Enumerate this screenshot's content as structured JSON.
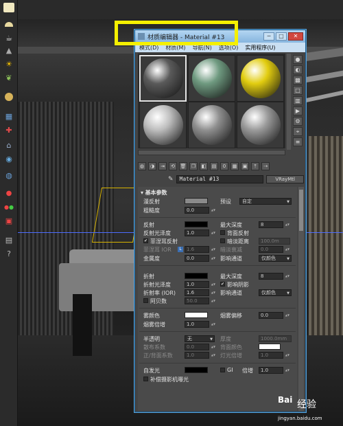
{
  "window": {
    "title": "材质编辑器 - Material #13",
    "controls": {
      "minimize": "─",
      "maximize": "□",
      "close": "✕"
    }
  },
  "menu": [
    "模式(D)",
    "材质(M)",
    "导航(N)",
    "选项(O)",
    "实用程序(U)"
  ],
  "slots": [
    {
      "color": "#5a5a5a",
      "selected": true
    },
    {
      "color": "#6f9a80",
      "selected": false
    },
    {
      "color": "#e2cd10",
      "selected": false
    },
    {
      "color": "#bdbdbd",
      "selected": false
    },
    {
      "color": "#8f8f8f",
      "selected": false
    },
    {
      "color": "#9a9a9a",
      "selected": false
    }
  ],
  "material_name": "Material #13",
  "material_type": "VRayMtl",
  "params": {
    "section_basic": "基本参数",
    "diffuse_label": "漫反射",
    "roughness_label": "粗糙度",
    "roughness_value": "0.0",
    "preset_label": "预设",
    "preset_value": "自定",
    "reflect_label": "反射",
    "max_depth_label": "最大深度",
    "reflect_max_depth": "8",
    "reflect_gloss_label": "反射光泽度",
    "reflect_gloss_value": "1.0",
    "back_reflect_label": "背面反射",
    "fresnel_label": "菲涅耳反射",
    "dim_dist_label": "暗淡距离",
    "dim_dist_value": "100.0m",
    "fresnel_ior_label": "菲涅耳 IOR",
    "fresnel_ior_value": "1.6",
    "dim_falloff_label": "暗淡衰减",
    "dim_falloff_value": "0.0",
    "metalness_label": "金属度",
    "metalness_value": "0.0",
    "affect_channels_label": "影响通道",
    "affect_channels_value": "仅颜色",
    "refract_label": "折射",
    "refract_max_depth": "8",
    "refract_gloss_label": "折射光泽度",
    "refract_gloss_value": "1.0",
    "affect_shadows_label": "影响阴影",
    "ior_label": "折射率 (IOR)",
    "ior_value": "1.6",
    "affect_channels_value2": "仅颜色",
    "abbe_label": "阿贝数",
    "abbe_value": "50.0",
    "fog_color_label": "雾颜色",
    "fog_bias_label": "烟雾偏移",
    "fog_bias_value": "0.0",
    "fog_mult_label": "烟雾倍增",
    "fog_mult_value": "1.0",
    "translucency_label": "半透明",
    "translucency_value": "无",
    "thickness_label": "厚度",
    "thickness_value": "1000.0mm",
    "scatter_label": "散布系数",
    "scatter_value": "0.0",
    "back_color_label": "背面颜色",
    "fwd_back_label": "正/背面系数",
    "fwd_back_value": "1.0",
    "light_mult_label": "灯光倍增",
    "light_mult_value": "1.0",
    "self_illum_label": "自发光",
    "gi_label": "GI",
    "multiplier_label": "倍增",
    "multiplier_value": "1.0",
    "compensate_label": "补偿摄影机曝光"
  },
  "watermark": {
    "logo": "Bai",
    "text": "经验",
    "url": "jingyan.baidu.com"
  }
}
